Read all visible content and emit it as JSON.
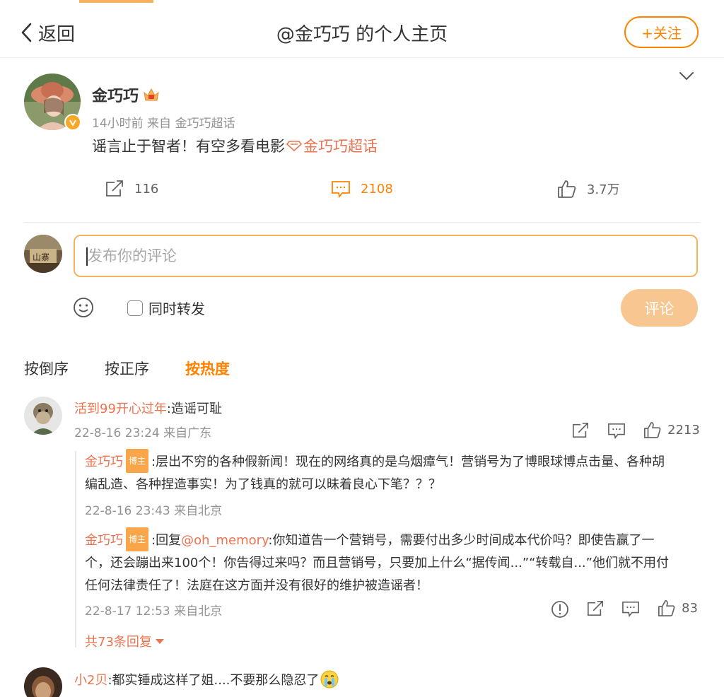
{
  "header": {
    "back_label": "返回",
    "title": "@金巧巧 的个人主页",
    "follow_label": "+关注"
  },
  "post": {
    "author": "金巧巧",
    "meta": "14小时前  来自 金巧巧超话",
    "text": "谣言止于智者！有空多看电影",
    "topic": "金巧巧超话",
    "reposts": "116",
    "comments": "2108",
    "likes": "3.7万"
  },
  "compose": {
    "placeholder": "发布你的评论",
    "repost_label": "同时转发",
    "submit_label": "评论"
  },
  "sort": {
    "tabs": [
      "按倒序",
      "按正序",
      "按热度"
    ],
    "active": "按热度"
  },
  "comments": [
    {
      "user": "活到99开心过年",
      "text": ":造谣可耻",
      "time": "22-8-16 23:24 来自广东",
      "likes": "2213",
      "replies": [
        {
          "user": "金巧巧",
          "badge": "博主",
          "line1": ":层出不穷的各种假新闻！现在的网络真的是乌烟瘴气！营销号为了博眼球博点击量、各种胡",
          "line2": "编乱造、各种捏造事实！为了钱真的就可以昧着良心下笔？？？",
          "time": "22-8-16 23:43 来自北京"
        },
        {
          "user": "金巧巧",
          "badge": "博主",
          "reply_prefix": ":回复",
          "mention": "@oh_memory",
          "line1": ":你知道告一个营销号，需要付出多少时间成本代价吗？即使告赢了一",
          "line2": "个，还会蹦出来100个！你告得过来吗？而且营销号，只要加上什么“据传闻...”“转载自...”他们就不用付",
          "line3": "任何法律责任了！法庭在这方面并没有很好的维护被造谣者！",
          "time": "22-8-17 12:53 来自北京",
          "likes": "83"
        }
      ],
      "more_replies": "共73条回复"
    },
    {
      "user": "小2贝",
      "text": ":都实锤成这样了姐....不要那么隐忍了"
    }
  ],
  "colors": {
    "accent": "#ff8200",
    "username": "#eb7350",
    "submit_disabled": "#f8c690",
    "input_border": "#f7b25e"
  }
}
